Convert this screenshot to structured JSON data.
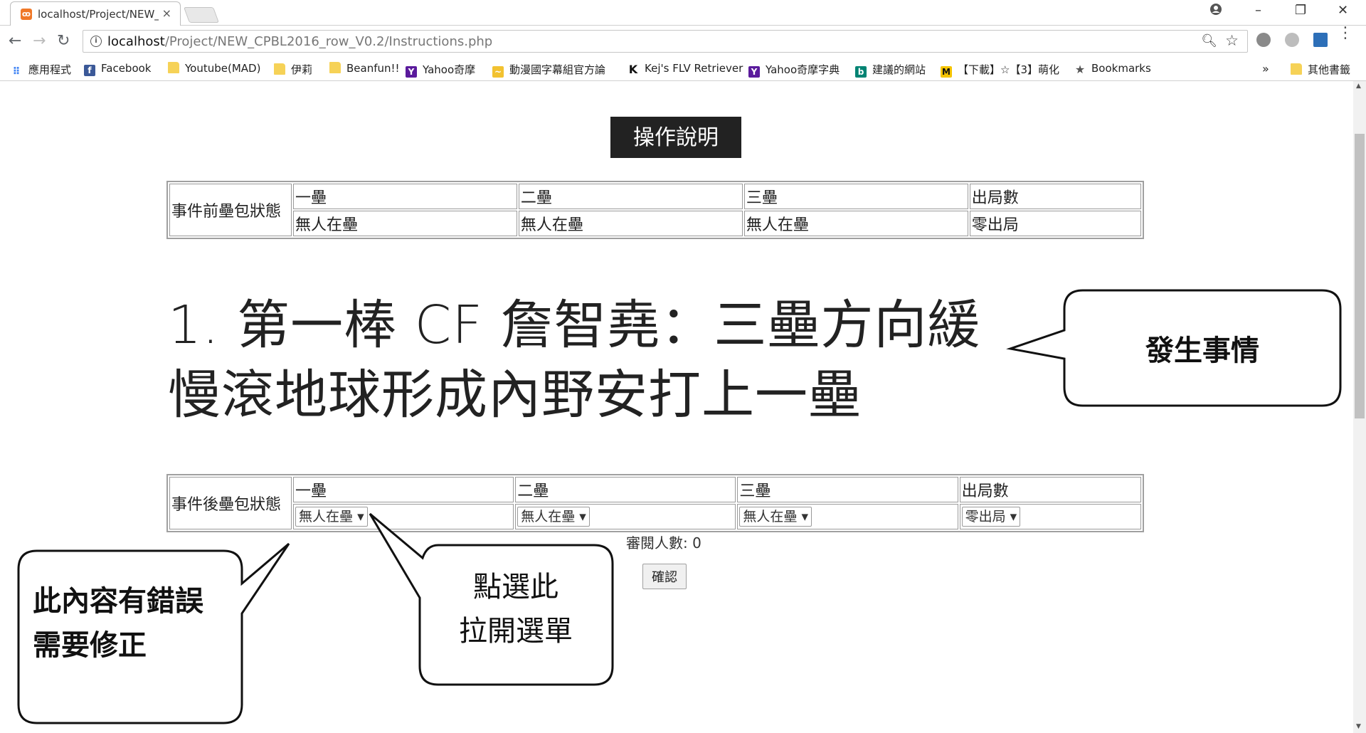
{
  "browser": {
    "tab_title": "localhost/Project/NEW_",
    "url_host": "localhost",
    "url_path": "/Project/NEW_CPBL2016_row_V0.2/Instructions.php"
  },
  "bookmarks": [
    {
      "label": "應用程式",
      "icon": "apps-grid-icon"
    },
    {
      "label": "Facebook",
      "icon": "facebook-icon"
    },
    {
      "label": "Youtube(MAD)",
      "icon": "folder-icon"
    },
    {
      "label": "伊莉",
      "icon": "folder-icon"
    },
    {
      "label": "Beanfun!!",
      "icon": "folder-icon"
    },
    {
      "label": "Yahoo奇摩",
      "icon": "yahoo-icon"
    },
    {
      "label": "動漫國字幕組官方論",
      "icon": "forum-icon"
    },
    {
      "label": "Kej's FLV Retriever",
      "icon": "k-icon"
    },
    {
      "label": "Yahoo奇摩字典",
      "icon": "yahoo-icon"
    },
    {
      "label": "建議的網站",
      "icon": "bing-icon"
    },
    {
      "label": "【下載】☆【3】萌化",
      "icon": "m-icon"
    },
    {
      "label": "Bookmarks",
      "icon": "star-icon"
    }
  ],
  "bookmarks_overflow": "»",
  "other_bookmarks": "其他書籤",
  "page": {
    "instructions_button": "操作說明",
    "before_table": {
      "row_header": "事件前壘包狀態",
      "columns": [
        "一壘",
        "二壘",
        "三壘",
        "出局數"
      ],
      "values": [
        "無人在壘",
        "無人在壘",
        "無人在壘",
        "零出局"
      ]
    },
    "event_text": "1. 第一棒 CF 詹智堯：三壘方向緩慢滾地球形成內野安打上一壘",
    "after_table": {
      "row_header": "事件後壘包狀態",
      "columns": [
        "一壘",
        "二壘",
        "三壘",
        "出局數"
      ],
      "selects": [
        "無人在壘",
        "無人在壘",
        "無人在壘",
        "零出局"
      ]
    },
    "viewers_label": "審閱人數: 0",
    "confirm_button": "確認"
  },
  "callouts": {
    "event_line1": "發生事情",
    "select_line1": "點選此",
    "select_line2": "拉開選單",
    "error_line1": "此內容有錯誤",
    "error_line2": "需要修正"
  }
}
